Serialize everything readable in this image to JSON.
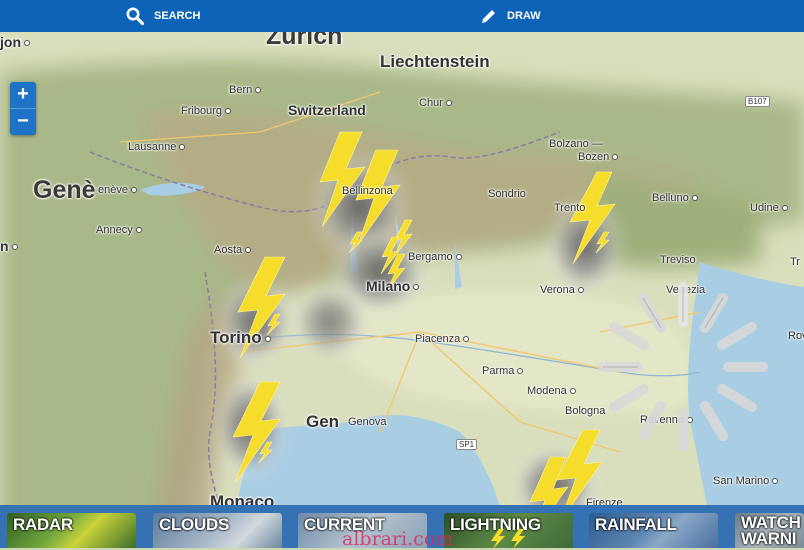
{
  "toolbar": {
    "search_label": "SEARCH",
    "draw_label": "DRAW"
  },
  "zoom": {
    "in_label": "+",
    "out_label": "−"
  },
  "map": {
    "countries": {
      "switzerland": "Switzerland",
      "liechtenstein": "Liechtenstein"
    },
    "cities_large": {
      "zurich": "Zürich",
      "geneve": "Genè",
      "milano": "Milano",
      "torino": "Torino",
      "genova_big": "Gen",
      "monaco": "Monaco"
    },
    "cities": {
      "dijon": "jon",
      "bern": "Bern",
      "fribourg": "Fribourg",
      "chur": "Chur",
      "lausanne": "Lausanne",
      "geneve_small": "enève",
      "annecy": "Annecy",
      "aosta": "Aosta",
      "bellinzona": "Bellinzona",
      "sondrio": "Sondrio",
      "bolzano": "Bolzano —",
      "bozen": "Bozen",
      "trento": "Trento",
      "belluno": "Belluno",
      "udine": "Udine",
      "bergamo": "Bergamo",
      "verona": "Verona",
      "treviso": "Treviso",
      "venezia": "Venezia",
      "piacenza": "Piacenza",
      "parma": "Parma",
      "modena": "Modena",
      "bologna": "Bologna",
      "ravenna": "Ravenna",
      "genova": "Genova",
      "san_marino": "San Marino",
      "firenze": "Firenze",
      "rovigo": "Rov",
      "trieste": "Tr",
      "lyon_edge": "n"
    },
    "road_shields": {
      "b107": "B107",
      "sp1": "SP1"
    }
  },
  "layers": [
    {
      "label": "RADAR",
      "color": "#3a7a2a"
    },
    {
      "label": "CLOUDS",
      "color": "#6f8fae"
    },
    {
      "label": "CURRENT",
      "color": "#8aa0b6"
    },
    {
      "label": "LIGHTNING",
      "color": "#3f6a3a"
    },
    {
      "label": "RAINFALL",
      "color": "#4a6fa0"
    },
    {
      "label": "WATCH WARNI",
      "color": "#7a8b95"
    }
  ],
  "watermark": "albrari.com"
}
